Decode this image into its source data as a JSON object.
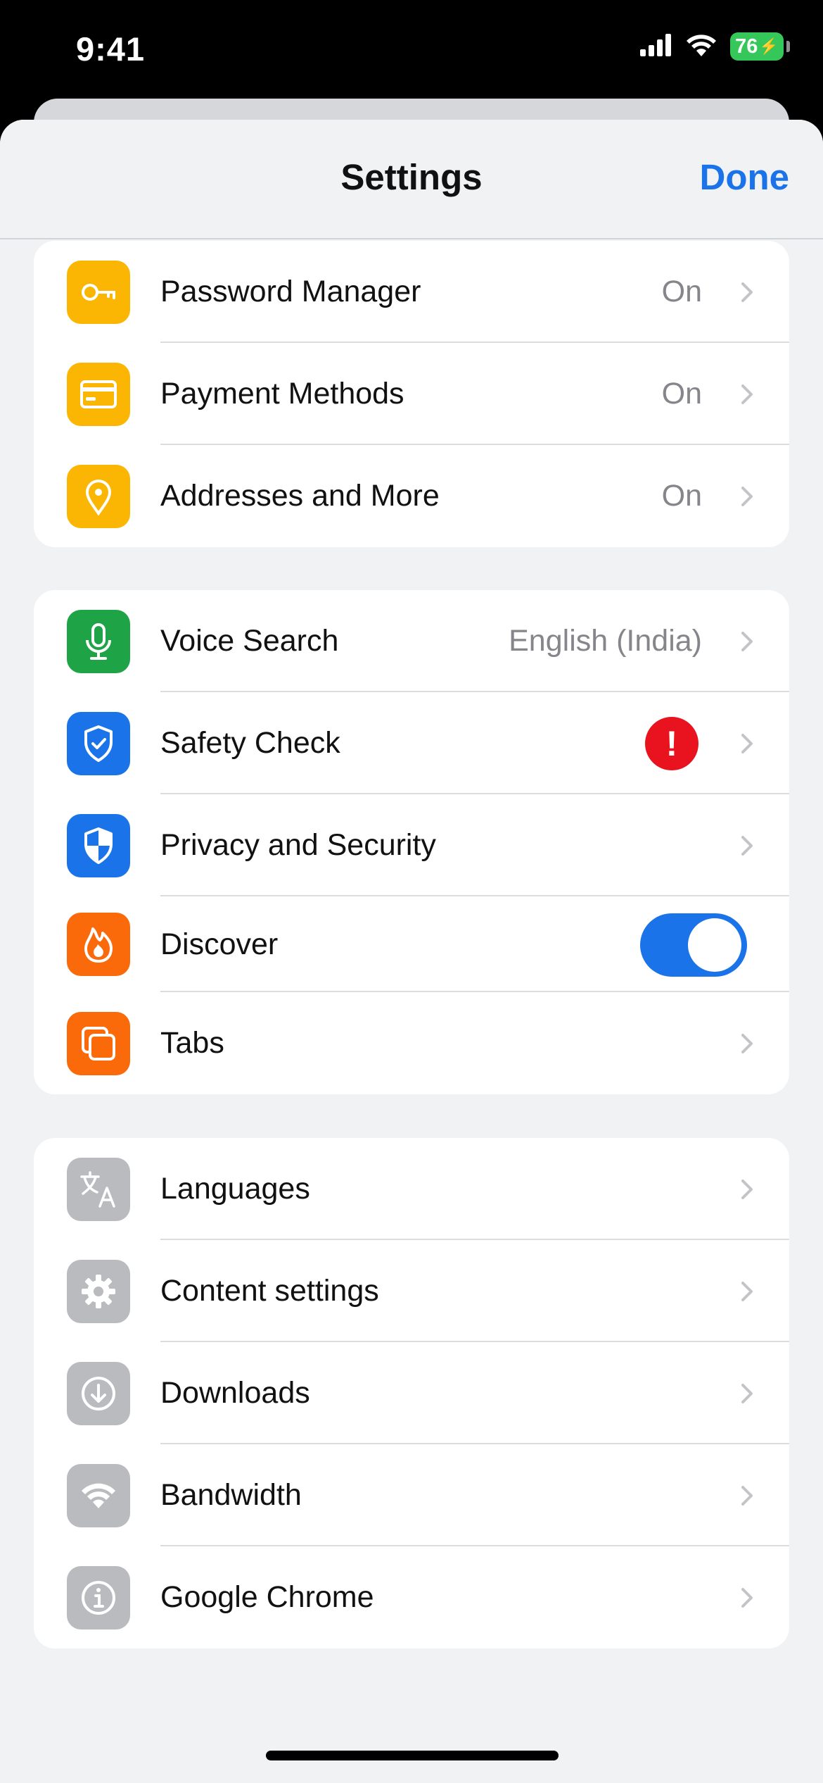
{
  "status_bar": {
    "time": "9:41",
    "battery": "76"
  },
  "nav": {
    "title": "Settings",
    "done_label": "Done"
  },
  "groups": [
    {
      "rows": [
        {
          "label": "Password Manager",
          "value": "On",
          "icon": "key-icon",
          "icon_color": "#fbb603"
        },
        {
          "label": "Payment Methods",
          "value": "On",
          "icon": "credit-card-icon",
          "icon_color": "#fbb603"
        },
        {
          "label": "Addresses and More",
          "value": "On",
          "icon": "location-pin-icon",
          "icon_color": "#fbb603"
        }
      ]
    },
    {
      "rows": [
        {
          "label": "Voice Search",
          "value": "English (India)",
          "icon": "microphone-icon",
          "icon_color": "#1ea446"
        },
        {
          "label": "Safety Check",
          "badge": "!",
          "icon": "shield-check-icon",
          "icon_color": "#1a73e8"
        },
        {
          "label": "Privacy and Security",
          "icon": "shield-icon",
          "icon_color": "#1a73e8"
        },
        {
          "label": "Discover",
          "toggle_on": true,
          "icon": "flame-icon",
          "icon_color": "#fa6a0a"
        },
        {
          "label": "Tabs",
          "icon": "tabs-icon",
          "icon_color": "#fa6a0a"
        }
      ]
    },
    {
      "rows": [
        {
          "label": "Languages",
          "icon": "translate-icon",
          "icon_color": "#b9bbbf"
        },
        {
          "label": "Content settings",
          "icon": "gear-icon",
          "icon_color": "#b9bbbf"
        },
        {
          "label": "Downloads",
          "icon": "download-icon",
          "icon_color": "#b9bbbf"
        },
        {
          "label": "Bandwidth",
          "icon": "wifi-icon",
          "icon_color": "#b9bbbf"
        },
        {
          "label": "Google Chrome",
          "icon": "info-icon",
          "icon_color": "#b9bbbf"
        }
      ]
    }
  ],
  "colors": {
    "accent": "#1a73e8",
    "alert": "#e8131f",
    "toggle_on": "#1a73e8"
  }
}
